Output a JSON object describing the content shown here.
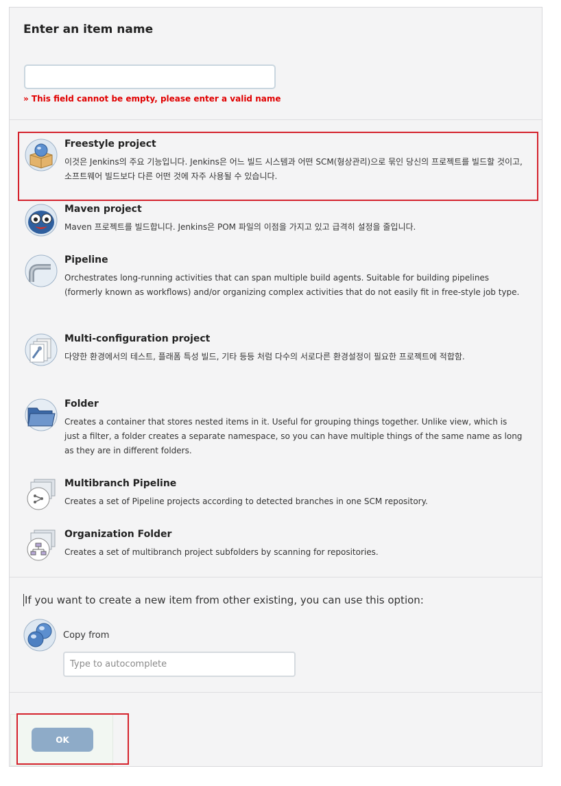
{
  "form": {
    "title": "Enter an item name",
    "name_value": "",
    "error": "» This field cannot be empty, please enter a valid name"
  },
  "items": [
    {
      "label": "Freestyle project",
      "icon": "freestyle-project-icon",
      "selected": true,
      "description": "이것은 Jenkins의 주요 기능입니다. Jenkins은 어느 빌드 시스템과 어떤 SCM(형상관리)으로 묶인 당신의 프로젝트를 빌드할 것이고, 소프트웨어 빌드보다 다른 어떤 것에 자주 사용될 수 있습니다."
    },
    {
      "label": "Maven project",
      "icon": "maven-project-icon",
      "description": "Maven 프로젝트를 빌드합니다. Jenkins은 POM 파일의 이점을 가지고 있고 급격히 설정을 줄입니다."
    },
    {
      "label": "Pipeline",
      "icon": "pipeline-icon",
      "description": "Orchestrates long-running activities that can span multiple build agents. Suitable for building pipelines (formerly known as workflows) and/or organizing complex activities that do not easily fit in free-style job type."
    },
    {
      "label": "Multi-configuration project",
      "icon": "multi-configuration-project-icon",
      "description": "다양한 환경에서의 테스트, 플래폼 특성 빌드, 기타 등등 처럼 다수의 서로다른 환경설정이 필요한 프로젝트에 적합함."
    },
    {
      "label": "Folder",
      "icon": "folder-icon",
      "description": "Creates a container that stores nested items in it. Useful for grouping things together. Unlike view, which is just a filter, a folder creates a separate namespace, so you can have multiple things of the same name as long as they are in different folders."
    },
    {
      "label": "Multibranch Pipeline",
      "icon": "multibranch-pipeline-icon",
      "description": "Creates a set of Pipeline projects according to detected branches in one SCM repository."
    },
    {
      "label": "Organization Folder",
      "icon": "organization-folder-icon",
      "description": "Creates a set of multibranch project subfolders by scanning for repositories."
    }
  ],
  "copy": {
    "heading": "If you want to create a new item from other existing, you can use this option:",
    "label": "Copy from",
    "placeholder": "Type to autocomplete",
    "icon": "copy-from-icon"
  },
  "footer": {
    "ok_label": "OK"
  },
  "colors": {
    "error": "#e00000",
    "highlight_border": "#d4212b",
    "ok_button": "#8eabc8"
  }
}
